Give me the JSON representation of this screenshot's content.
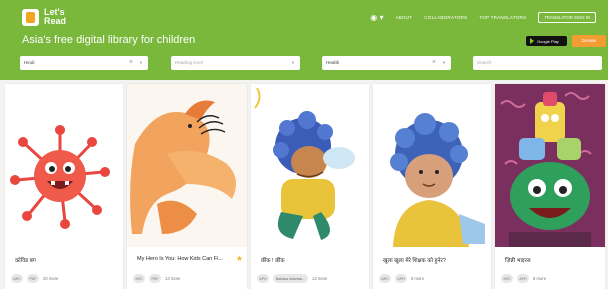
{
  "header": {
    "logo_text": "Let's Read",
    "tagline": "Asia's free digital library for children",
    "language_icon": "globe-icon",
    "nav": [
      "ABOUT",
      "COLLABORATORS",
      "TOP TRANSLATORS"
    ],
    "signin_label": "TRANSLATOR SIGN IN",
    "store_badge": "Google Play",
    "donate_label": "Donate"
  },
  "filters": {
    "language_value": "Hindi",
    "reading_level_placeholder": "Reading level",
    "category_value": "Health",
    "search_placeholder": "Search"
  },
  "books": [
    {
      "title": "कोविड बग",
      "chips": [
        "ARC",
        "PDF"
      ],
      "more": "20 more"
    },
    {
      "title": "My Hero Is You: How Kids Can Fi...",
      "chips": [
        "ARC",
        "PDF"
      ],
      "more": "13 more"
    },
    {
      "title": "छींक ! छींक",
      "chips": [
        "APH"
      ],
      "chip_wide": "Bahasa Indonesi...",
      "more": "13 more"
    },
    {
      "title": "खुला खुला मेरे शिक्षक को हुनेर?",
      "chips": [
        "ARC",
        "APH"
      ],
      "more": "6 more"
    },
    {
      "title": "ज़िन्नी भाइरस",
      "chips": [
        "ARC",
        "APH"
      ],
      "more": "8 more"
    }
  ],
  "colors": {
    "brand_green": "#79b83b",
    "donate_orange": "#f39c34",
    "star": "#f5b12a"
  }
}
